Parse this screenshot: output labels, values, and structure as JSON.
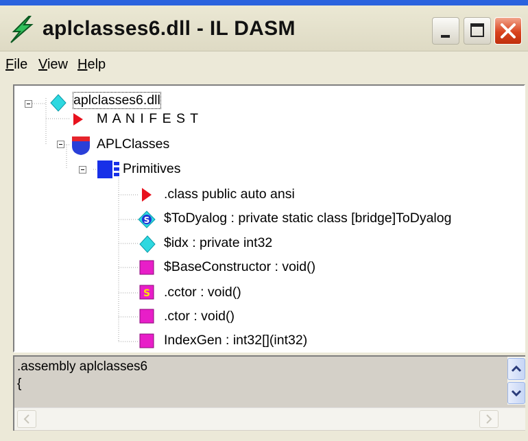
{
  "window": {
    "title": "aplclasses6.dll - IL DASM",
    "accent": "#2a63de"
  },
  "menu": {
    "file": {
      "label": "ile",
      "mnemonic": "F"
    },
    "view": {
      "label": "iew",
      "mnemonic": "V"
    },
    "help": {
      "label": "elp",
      "mnemonic": "H"
    }
  },
  "tree": {
    "root": {
      "label": "aplclasses6.dll",
      "icon": "assembly-diamond-icon"
    },
    "manifest": {
      "label": "M A N I F E S T",
      "icon": "red-triangle-icon"
    },
    "namespace": {
      "label": "APLClasses",
      "icon": "namespace-shield-icon"
    },
    "class": {
      "label": "Primitives",
      "icon": "class-icon"
    },
    "members": [
      {
        "label": ".class public auto ansi",
        "icon": "red-triangle-icon"
      },
      {
        "label": "$ToDyalog : private static class [bridge]ToDyalog",
        "icon": "static-field-icon"
      },
      {
        "label": "$idx : private int32",
        "icon": "field-diamond-icon"
      },
      {
        "label": "$BaseConstructor : void()",
        "icon": "method-icon"
      },
      {
        "label": ".cctor : void()",
        "icon": "static-method-icon"
      },
      {
        "label": ".ctor : void()",
        "icon": "method-icon"
      },
      {
        "label": "IndexGen : int32[](int32)",
        "icon": "method-icon"
      }
    ]
  },
  "status": {
    "line1": ".assembly aplclasses6",
    "line2": "{"
  }
}
